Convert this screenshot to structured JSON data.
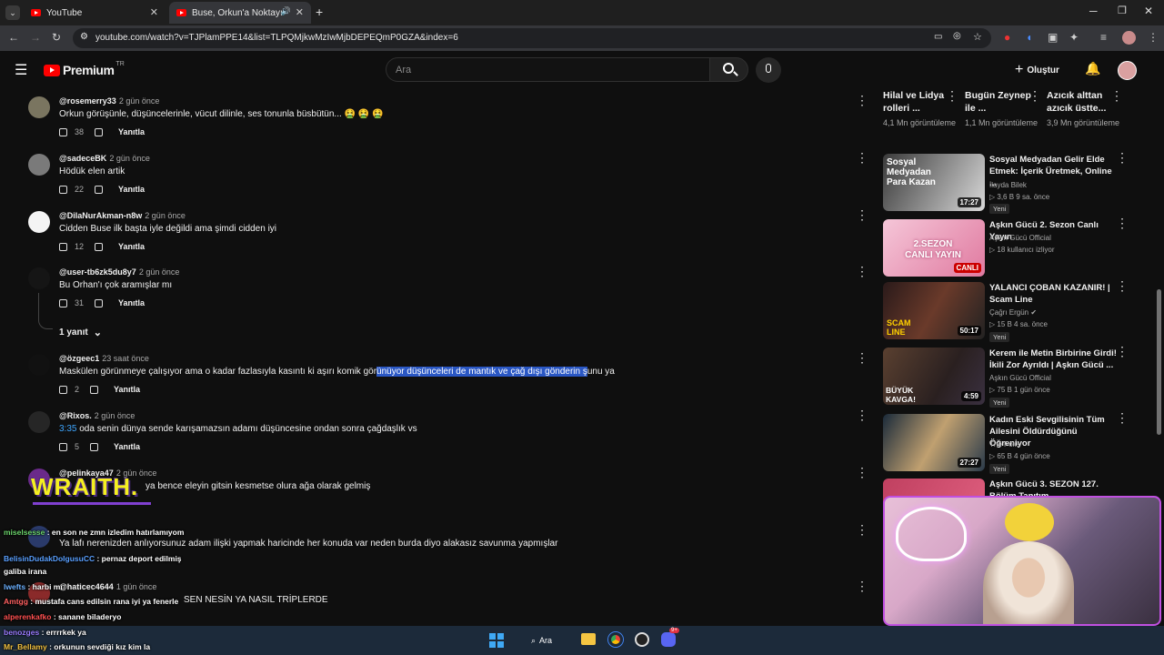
{
  "browser": {
    "tabs": [
      {
        "label": "YouTube"
      },
      {
        "label": "Buse, Orkun'a Noktayı Koydu"
      }
    ],
    "url": "youtube.com/watch?v=TJPlamPPE14&list=TLPQMjkwMzIwMjbDEPEQmP0GZA&index=6"
  },
  "header": {
    "logo": "Premium",
    "country": "TR",
    "search_placeholder": "Ara",
    "create_label": "Oluştur"
  },
  "comments": [
    {
      "user": "@rosemerry33",
      "time": "2 gün önce",
      "text": "Orkun görüşünle, düşüncelerinle, vücut dilinle, ses tonunla büsbütün... 🤮 🤮 🤮",
      "likes": "38",
      "reply": "Yanıtla"
    },
    {
      "user": "@sadeceBK",
      "time": "2 gün önce",
      "text": "Hödük elen artik",
      "likes": "22",
      "reply": "Yanıtla"
    },
    {
      "user": "@DilaNurAkman-n8w",
      "time": "2 gün önce",
      "text": "Cidden Buse ilk başta iyle değildi ama şimdi cidden iyi",
      "likes": "12",
      "reply": "Yanıtla"
    },
    {
      "user": "@user-tb6zk5du8y7",
      "time": "2 gün önce",
      "text": "Bu Orhan'ı çok aramışlar mı",
      "likes": "31",
      "reply": "Yanıtla"
    },
    {
      "user": "@özgeec1",
      "time": "23 saat önce",
      "text_pre": "Maskülen görünmeye çalışıyor ama o kadar fazlasıyla kasıntı ki aşırı komik gör",
      "text_hl": "ünüyor düşünceleri de mantık ve çağ dışı gönderin ş",
      "text_post": "unu ya",
      "likes": "2",
      "reply": "Yanıtla"
    },
    {
      "user": "@Rixos.",
      "time": "2 gün önce",
      "timestamp": "3:35",
      "text": " oda senin dünya sende karışamazsın adamı düşüncesine ondan sonra çağdaşlık vs",
      "likes": "5",
      "reply": "Yanıtla"
    },
    {
      "user": "@pelinkaya47",
      "time": "2 gün önce",
      "text": "ya bence eleyin gitsin kesmetse olura  ağa olarak gelmiş",
      "likes": "",
      "reply": ""
    },
    {
      "user": "",
      "time": "",
      "text": "Ya lafı nerenizden anlıyorsunuz adam ilişki yapmak haricinde her konuda var neden burda diyo alakasız savunma yapmışlar",
      "likes": "",
      "reply": ""
    },
    {
      "user": "@haticec4644",
      "time": "1 gün önce",
      "text": "SEN NESİN YA NASIL TRİPLERDE",
      "likes": "",
      "reply": ""
    }
  ],
  "replies_toggle": "1 yanıt",
  "top_recommendations": [
    {
      "title": "Hilal ve Lidya rolleri ...",
      "views": "4,1 Mn görüntüleme"
    },
    {
      "title": "Bugün Zeynep ile ...",
      "views": "1,1 Mn görüntüleme"
    },
    {
      "title": "Azıcık alttan azıcık üstte...",
      "views": "3,9 Mn görüntüleme"
    }
  ],
  "recommendations": [
    {
      "title": "Sosyal Medyadan Gelir Elde Etmek: İçerik Üretmek, Online ...",
      "channel": "İlayda Bilek",
      "meta": "▷ 3,6 B  9 sa. önce",
      "badge": "Yeni",
      "duration": "17:27",
      "thumb_text": "Sosyal Medyadan Para Kazan"
    },
    {
      "title": "Aşkın Gücü 2. Sezon Canlı Yayın",
      "channel": "Aşkın Gücü Official",
      "meta": "▷ 18 kullanıcı izliyor",
      "badge": "",
      "duration": "CANLI",
      "thumb_text": "2.SEZON CANLI YAYIN"
    },
    {
      "title": "YALANCI ÇOBAN KAZANIR! | Scam Line",
      "channel": "Çağrı Ergün ✔",
      "meta": "▷ 15 B  4 sa. önce",
      "badge": "Yeni",
      "duration": "50:17",
      "thumb_text": "SCAM LINE"
    },
    {
      "title": "Kerem ile Metin Birbirine Girdi! İkili Zor Ayrıldı | Aşkın Gücü ...",
      "channel": "Aşkın Gücü Official",
      "meta": "▷ 75 B  1 gün önce",
      "badge": "Yeni",
      "duration": "4:59",
      "thumb_text": "BÜYÜK KAVGA!"
    },
    {
      "title": "Kadın Eski Sevgilisinin Tüm Ailesini Öldürdüğünü Öğreniyor",
      "channel": "The Polis",
      "meta": "▷ 65 B  4 gün önce",
      "badge": "Yeni",
      "duration": "27:27",
      "thumb_text": ""
    },
    {
      "title": "Aşkın Gücü 3. SEZON 127. Bölüm Tanıtım",
      "channel": "",
      "meta": "",
      "badge": "",
      "duration": "",
      "thumb_text": ""
    }
  ],
  "overlay": {
    "logo_text": "WRAITH.",
    "chat": [
      {
        "user": "miselsesse",
        "msg": " : en son ne zmn izledim hatırlamıyom",
        "color": "#6bd36b"
      },
      {
        "user": "BelisinDudakDolgusuCC",
        "msg": " : pernaz deport edilmiş",
        "color": "#5aa0ff"
      },
      {
        "user": "",
        "msg": "galiba irana",
        "color": "#ffffff"
      },
      {
        "user": "lwefts",
        "msg": " : harbi mı",
        "color": "#6bb0ff"
      },
      {
        "user": "Amtgg",
        "msg": " : mustafa cans edilsin rana iyi ya fenerle",
        "color": "#ff6060"
      },
      {
        "user": "alperenkafko",
        "msg": " : sanane biladeryo",
        "color": "#ff5050"
      },
      {
        "user": "benozges",
        "msg": " : errrrkek ya",
        "color": "#9a7cff"
      },
      {
        "user": "Mr_Bellamy",
        "msg": " : orkunun sevdiği kız kim la",
        "color": "#f0c040"
      }
    ]
  },
  "taskbar": {
    "search_label": "Ara",
    "discord_badge": "9+"
  }
}
